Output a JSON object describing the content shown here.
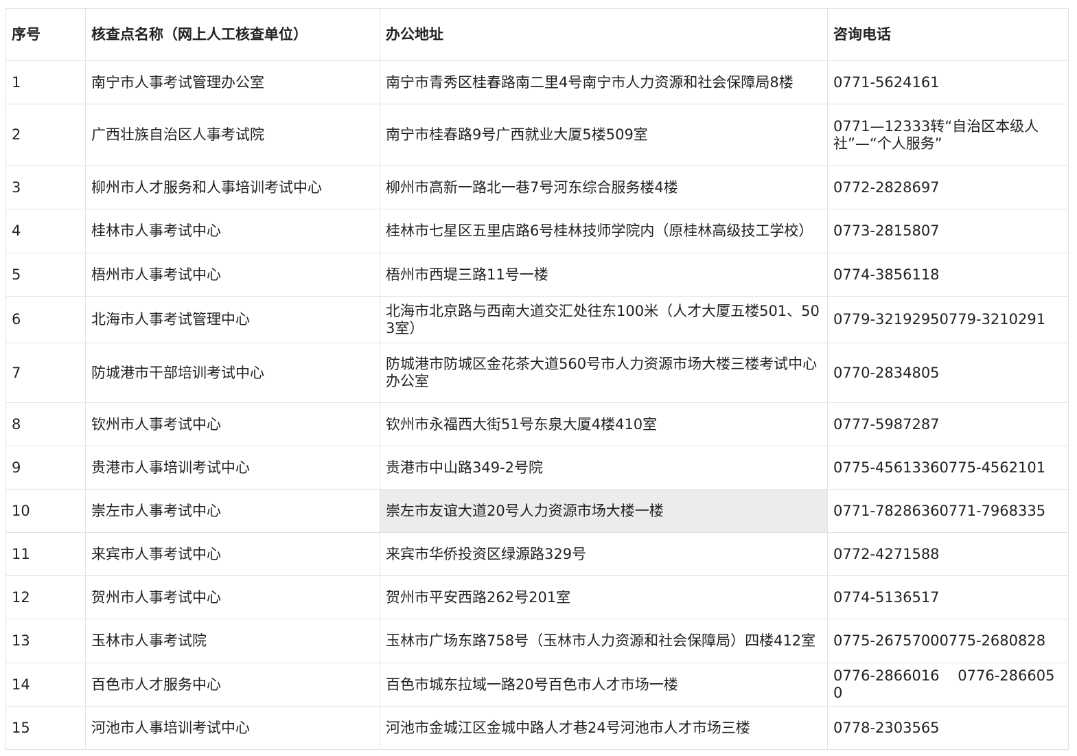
{
  "table": {
    "headers": [
      "序号",
      "核查点名称（网上人工核查单位）",
      "办公地址",
      "咨询电话"
    ],
    "highlight_row": 9,
    "highlight_color": "#ececec",
    "rows": [
      {
        "no": "1",
        "name": "南宁市人事考试管理办公室",
        "address": "南宁市青秀区桂春路南二里4号南宁市人力资源和社会保障局8楼",
        "phone": "0771-5624161"
      },
      {
        "no": "2",
        "name": "广西壮族自治区人事考试院",
        "address": "南宁市桂春路9号广西就业大厦5楼509室",
        "phone": "0771—12333转“自治区本级人社”—“个人服务”"
      },
      {
        "no": "3",
        "name": "柳州市人才服务和人事培训考试中心",
        "address": "柳州市高新一路北一巷7号河东综合服务楼4楼",
        "phone": "0772-2828697"
      },
      {
        "no": "4",
        "name": "桂林市人事考试中心",
        "address": "桂林市七星区五里店路6号桂林技师学院内（原桂林高级技工学校）",
        "phone": "0773-2815807"
      },
      {
        "no": "5",
        "name": "梧州市人事考试中心",
        "address": "梧州市西堤三路11号一楼",
        "phone": "0774-3856118"
      },
      {
        "no": "6",
        "name": "北海市人事考试管理中心",
        "address": "北海市北京路与西南大道交汇处往东100米（人才大厦五楼501、503室）",
        "phone": "0779-32192950779-3210291"
      },
      {
        "no": "7",
        "name": "防城港市干部培训考试中心",
        "address": "防城港市防城区金花茶大道560号市人力资源市场大楼三楼考试中心办公室",
        "phone": "0770-2834805"
      },
      {
        "no": "8",
        "name": "钦州市人事考试中心",
        "address": "钦州市永福西大街51号东泉大厦4楼410室",
        "phone": "0777-5987287"
      },
      {
        "no": "9",
        "name": "贵港市人事培训考试中心",
        "address": "贵港市中山路349-2号院",
        "phone": "0775-45613360775-4562101"
      },
      {
        "no": "10",
        "name": "崇左市人事考试中心",
        "address": "崇左市友谊大道20号人力资源市场大楼一楼",
        "phone": "0771-78286360771-7968335"
      },
      {
        "no": "11",
        "name": "来宾市人事考试中心",
        "address": "来宾市华侨投资区绿源路329号",
        "phone": "0772-4271588"
      },
      {
        "no": "12",
        "name": "贺州市人事考试中心",
        "address": "贺州市平安西路262号201室",
        "phone": "0774-5136517"
      },
      {
        "no": "13",
        "name": "玉林市人事考试院",
        "address": "玉林市广场东路758号（玉林市人力资源和社会保障局）四楼412室",
        "phone": "0775-26757000775-2680828"
      },
      {
        "no": "14",
        "name": "百色市人才服务中心",
        "address": "百色市城东拉域一路20号百色市人才市场一楼",
        "phone": "0776-2866016    0776-2866050"
      },
      {
        "no": "15",
        "name": "河池市人事培训考试中心",
        "address": "河池市金城江区金城中路人才巷24号河池市人才市场三楼",
        "phone": "0778-2303565"
      }
    ]
  }
}
